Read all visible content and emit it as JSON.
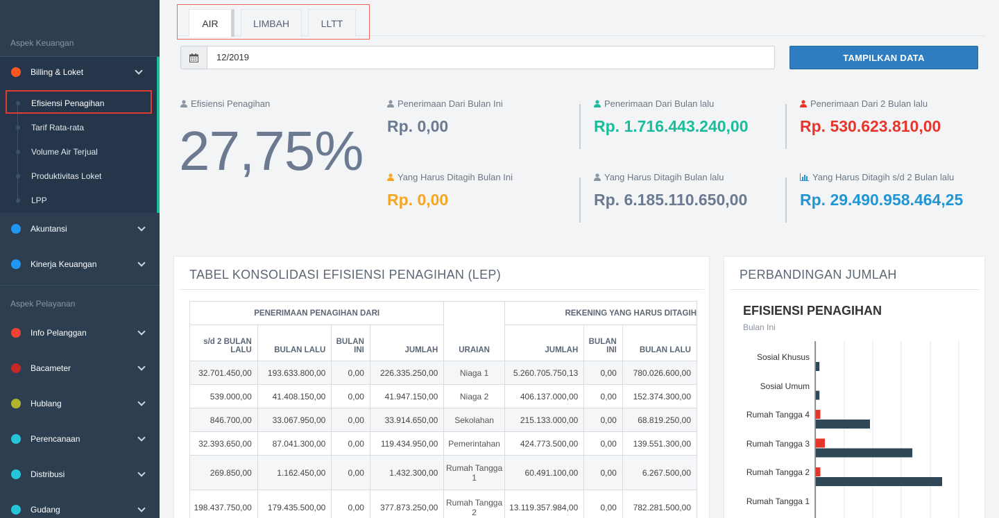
{
  "sidebar": {
    "section_keuangan": "Aspek Keuangan",
    "section_pelayanan": "Aspek Pelayanan",
    "items_keuangan": [
      {
        "label": "Billing & Loket",
        "color": "#ff5722"
      },
      {
        "label": "Akuntansi",
        "color": "#2196f3"
      },
      {
        "label": "Kinerja Keuangan",
        "color": "#2196f3"
      }
    ],
    "billing_sub": [
      "Efisiensi Penagihan",
      "Tarif Rata-rata",
      "Volume Air Terjual",
      "Produktivitas Loket",
      "LPP"
    ],
    "items_pelayanan": [
      {
        "label": "Info Pelanggan",
        "color": "#f44336"
      },
      {
        "label": "Bacameter",
        "color": "#c62828"
      },
      {
        "label": "Hublang",
        "color": "#afb42b"
      },
      {
        "label": "Perencanaan",
        "color": "#26c6da"
      },
      {
        "label": "Distribusi",
        "color": "#26c6da"
      },
      {
        "label": "Gudang",
        "color": "#26c6da"
      }
    ]
  },
  "tabs": [
    "AIR",
    "LIMBAH",
    "LLTT"
  ],
  "filter": {
    "date_value": "12/2019",
    "submit_label": "TAMPILKAN DATA"
  },
  "stats": {
    "efisiensi": {
      "label": "Efisiensi Penagihan",
      "value": "27,75%"
    },
    "terima_ini": {
      "label": "Penerimaan Dari Bulan Ini",
      "value": "Rp. 0,00",
      "color": "#6b7a90"
    },
    "terima_lalu": {
      "label": "Penerimaan Dari Bulan lalu",
      "value": "Rp. 1.716.443.240,00",
      "color": "#1abc9c"
    },
    "terima_2": {
      "label": "Penerimaan Dari 2 Bulan lalu",
      "value": "Rp. 530.623.810,00",
      "color": "#e8352a"
    },
    "tagih_ini": {
      "label": "Yang Harus Ditagih Bulan Ini",
      "value": "Rp. 0,00",
      "color": "#f5a623"
    },
    "tagih_lalu": {
      "label": "Yang Harus Ditagih Bulan lalu",
      "value": "Rp. 6.185.110.650,00",
      "color": "#6b7a90"
    },
    "tagih_2": {
      "label": "Yang Harus Ditagih s/d 2 Bulan lalu",
      "value": "Rp. 29.490.958.464,25",
      "color": "#2196d3"
    }
  },
  "table_card": {
    "title": "TABEL KONSOLIDASI EFISIENSI PENAGIHAN (LEP)",
    "group_left": "PENERIMAAN PENAGIHAN DARI",
    "group_right": "REKENING YANG HARUS DITAGIH",
    "uraian": "URAIAN",
    "left_cols": [
      "s/d 2 BULAN LALU",
      "BULAN LALU",
      "BULAN INI",
      "JUMLAH"
    ],
    "right_cols": [
      "JUMLAH",
      "BULAN INI",
      "BULAN LALU"
    ],
    "rows": [
      {
        "c": [
          "32.701.450,00",
          "193.633.800,00",
          "0,00",
          "226.335.250,00"
        ],
        "u": "Niaga 1",
        "r": [
          "5.260.705.750,13",
          "0,00",
          "780.026.600,00"
        ]
      },
      {
        "c": [
          "539.000,00",
          "41.408.150,00",
          "0,00",
          "41.947.150,00"
        ],
        "u": "Niaga 2",
        "r": [
          "406.137.000,00",
          "0,00",
          "152.374.300,00"
        ]
      },
      {
        "c": [
          "846.700,00",
          "33.067.950,00",
          "0,00",
          "33.914.650,00"
        ],
        "u": "Sekolahan",
        "r": [
          "215.133.000,00",
          "0,00",
          "68.819.250,00"
        ]
      },
      {
        "c": [
          "32.393.650,00",
          "87.041.300,00",
          "0,00",
          "119.434.950,00"
        ],
        "u": "Pemerintahan",
        "r": [
          "424.773.500,00",
          "0,00",
          "139.551.300,00"
        ]
      },
      {
        "c": [
          "269.850,00",
          "1.162.450,00",
          "0,00",
          "1.432.300,00"
        ],
        "u": "Rumah Tangga 1",
        "r": [
          "60.491.100,00",
          "0,00",
          "6.267.500,00"
        ]
      },
      {
        "c": [
          "198.437.750,00",
          "179.435.500,00",
          "0,00",
          "377.873.250,00"
        ],
        "u": "Rumah Tangga 2",
        "r": [
          "13.119.357.984,00",
          "0,00",
          "782.281.500,00"
        ]
      }
    ]
  },
  "chart_card": {
    "title": "PERBANDINGAN JUMLAH"
  },
  "chart_data": {
    "type": "bar",
    "orientation": "horizontal",
    "title": "EFISIENSI PENAGIHAN",
    "subtitle": "Bulan Ini",
    "categories": [
      "Sosial Khusus",
      "Sosial Umum",
      "Rumah Tangga 4",
      "Rumah Tangga 3",
      "Rumah Tangga 2",
      "Rumah Tangga 1"
    ],
    "series": [
      {
        "color": "#e8352a",
        "values": [
          0,
          0,
          0.05,
          0.1,
          0.05,
          0
        ]
      },
      {
        "color": "#2f4858",
        "values": [
          0.04,
          0.04,
          0.6,
          1.07,
          1.4,
          0
        ]
      }
    ],
    "grid": true
  }
}
